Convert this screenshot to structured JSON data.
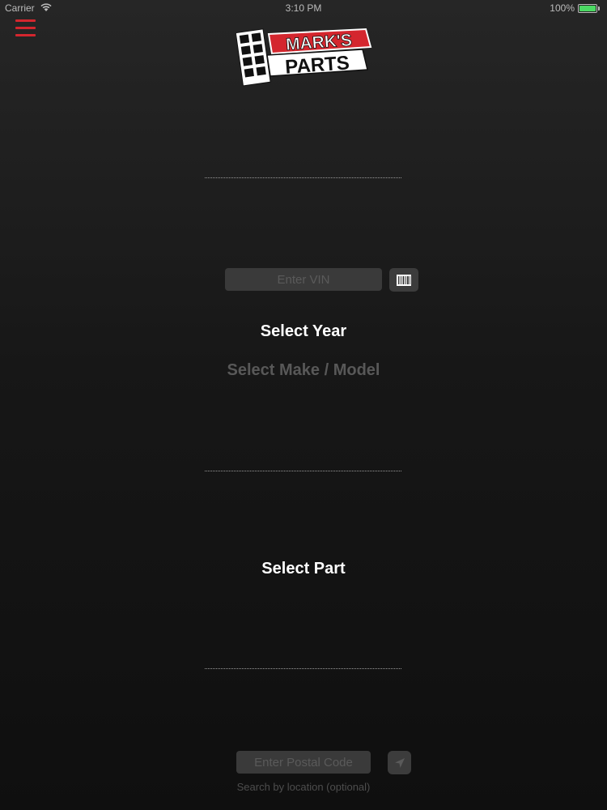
{
  "status_bar": {
    "carrier": "Carrier",
    "time": "3:10 PM",
    "battery": "100%",
    "battery_level": 1.0,
    "battery_color": "#4cd964"
  },
  "header": {
    "menu_icon": "hamburger-menu-icon",
    "menu_color": "#d4262e",
    "logo": {
      "line1": "MARK'S",
      "line2": "PARTS",
      "brand_red": "#d4262e"
    }
  },
  "vin": {
    "placeholder": "Enter VIN",
    "value": "",
    "scan_icon": "barcode-icon"
  },
  "selectors": {
    "year": "Select Year",
    "make_model": "Select Make / Model",
    "part": "Select Part"
  },
  "location": {
    "postal_placeholder": "Enter Postal Code",
    "postal_value": "",
    "location_icon": "location-icon",
    "hint": "Search by location (optional)"
  }
}
